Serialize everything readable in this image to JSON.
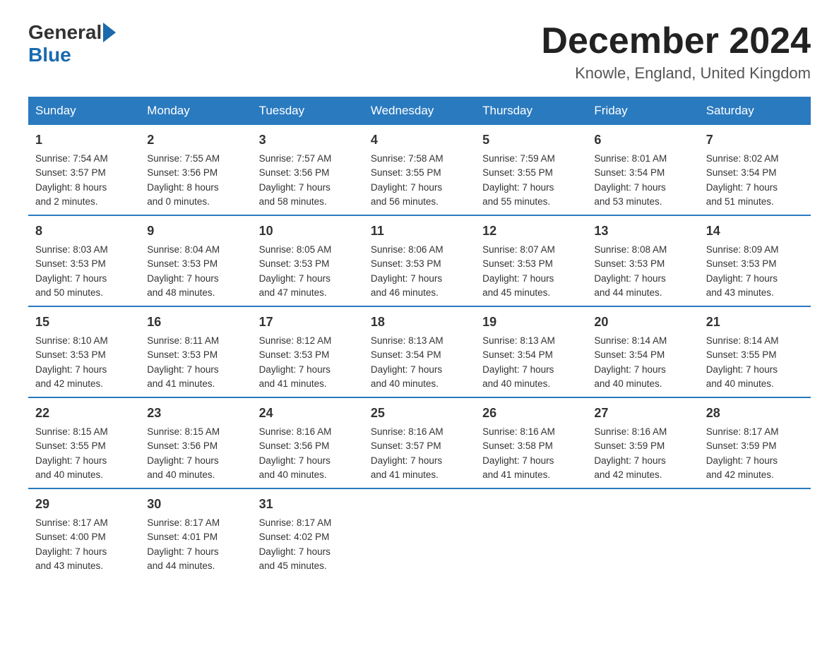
{
  "header": {
    "logo_general": "General",
    "logo_blue": "Blue",
    "title": "December 2024",
    "location": "Knowle, England, United Kingdom"
  },
  "days_of_week": [
    "Sunday",
    "Monday",
    "Tuesday",
    "Wednesday",
    "Thursday",
    "Friday",
    "Saturday"
  ],
  "weeks": [
    [
      {
        "day": "1",
        "sunrise": "7:54 AM",
        "sunset": "3:57 PM",
        "daylight": "8 hours and 2 minutes."
      },
      {
        "day": "2",
        "sunrise": "7:55 AM",
        "sunset": "3:56 PM",
        "daylight": "8 hours and 0 minutes."
      },
      {
        "day": "3",
        "sunrise": "7:57 AM",
        "sunset": "3:56 PM",
        "daylight": "7 hours and 58 minutes."
      },
      {
        "day": "4",
        "sunrise": "7:58 AM",
        "sunset": "3:55 PM",
        "daylight": "7 hours and 56 minutes."
      },
      {
        "day": "5",
        "sunrise": "7:59 AM",
        "sunset": "3:55 PM",
        "daylight": "7 hours and 55 minutes."
      },
      {
        "day": "6",
        "sunrise": "8:01 AM",
        "sunset": "3:54 PM",
        "daylight": "7 hours and 53 minutes."
      },
      {
        "day": "7",
        "sunrise": "8:02 AM",
        "sunset": "3:54 PM",
        "daylight": "7 hours and 51 minutes."
      }
    ],
    [
      {
        "day": "8",
        "sunrise": "8:03 AM",
        "sunset": "3:53 PM",
        "daylight": "7 hours and 50 minutes."
      },
      {
        "day": "9",
        "sunrise": "8:04 AM",
        "sunset": "3:53 PM",
        "daylight": "7 hours and 48 minutes."
      },
      {
        "day": "10",
        "sunrise": "8:05 AM",
        "sunset": "3:53 PM",
        "daylight": "7 hours and 47 minutes."
      },
      {
        "day": "11",
        "sunrise": "8:06 AM",
        "sunset": "3:53 PM",
        "daylight": "7 hours and 46 minutes."
      },
      {
        "day": "12",
        "sunrise": "8:07 AM",
        "sunset": "3:53 PM",
        "daylight": "7 hours and 45 minutes."
      },
      {
        "day": "13",
        "sunrise": "8:08 AM",
        "sunset": "3:53 PM",
        "daylight": "7 hours and 44 minutes."
      },
      {
        "day": "14",
        "sunrise": "8:09 AM",
        "sunset": "3:53 PM",
        "daylight": "7 hours and 43 minutes."
      }
    ],
    [
      {
        "day": "15",
        "sunrise": "8:10 AM",
        "sunset": "3:53 PM",
        "daylight": "7 hours and 42 minutes."
      },
      {
        "day": "16",
        "sunrise": "8:11 AM",
        "sunset": "3:53 PM",
        "daylight": "7 hours and 41 minutes."
      },
      {
        "day": "17",
        "sunrise": "8:12 AM",
        "sunset": "3:53 PM",
        "daylight": "7 hours and 41 minutes."
      },
      {
        "day": "18",
        "sunrise": "8:13 AM",
        "sunset": "3:54 PM",
        "daylight": "7 hours and 40 minutes."
      },
      {
        "day": "19",
        "sunrise": "8:13 AM",
        "sunset": "3:54 PM",
        "daylight": "7 hours and 40 minutes."
      },
      {
        "day": "20",
        "sunrise": "8:14 AM",
        "sunset": "3:54 PM",
        "daylight": "7 hours and 40 minutes."
      },
      {
        "day": "21",
        "sunrise": "8:14 AM",
        "sunset": "3:55 PM",
        "daylight": "7 hours and 40 minutes."
      }
    ],
    [
      {
        "day": "22",
        "sunrise": "8:15 AM",
        "sunset": "3:55 PM",
        "daylight": "7 hours and 40 minutes."
      },
      {
        "day": "23",
        "sunrise": "8:15 AM",
        "sunset": "3:56 PM",
        "daylight": "7 hours and 40 minutes."
      },
      {
        "day": "24",
        "sunrise": "8:16 AM",
        "sunset": "3:56 PM",
        "daylight": "7 hours and 40 minutes."
      },
      {
        "day": "25",
        "sunrise": "8:16 AM",
        "sunset": "3:57 PM",
        "daylight": "7 hours and 41 minutes."
      },
      {
        "day": "26",
        "sunrise": "8:16 AM",
        "sunset": "3:58 PM",
        "daylight": "7 hours and 41 minutes."
      },
      {
        "day": "27",
        "sunrise": "8:16 AM",
        "sunset": "3:59 PM",
        "daylight": "7 hours and 42 minutes."
      },
      {
        "day": "28",
        "sunrise": "8:17 AM",
        "sunset": "3:59 PM",
        "daylight": "7 hours and 42 minutes."
      }
    ],
    [
      {
        "day": "29",
        "sunrise": "8:17 AM",
        "sunset": "4:00 PM",
        "daylight": "7 hours and 43 minutes."
      },
      {
        "day": "30",
        "sunrise": "8:17 AM",
        "sunset": "4:01 PM",
        "daylight": "7 hours and 44 minutes."
      },
      {
        "day": "31",
        "sunrise": "8:17 AM",
        "sunset": "4:02 PM",
        "daylight": "7 hours and 45 minutes."
      },
      null,
      null,
      null,
      null
    ]
  ],
  "labels": {
    "sunrise": "Sunrise:",
    "sunset": "Sunset:",
    "daylight": "Daylight:"
  }
}
